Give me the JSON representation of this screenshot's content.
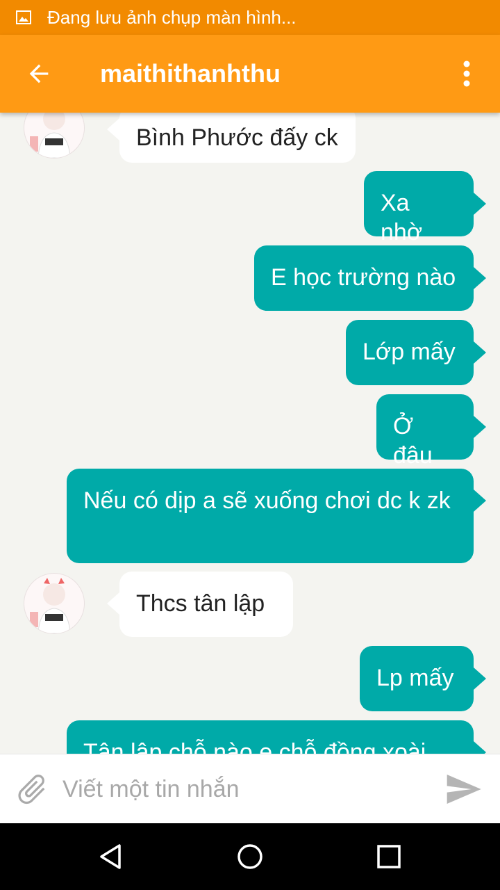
{
  "status_bar": {
    "icon": "image-icon",
    "text": "Đang lưu ảnh chụp màn hình..."
  },
  "app_bar": {
    "back_icon": "arrow-left-icon",
    "title": "maithithanhthu",
    "menu_icon": "more-vert-icon"
  },
  "colors": {
    "status_bar": "#f28a00",
    "app_bar": "#ff9a14",
    "outgoing_bubble": "#00aaa8",
    "incoming_bubble": "#ffffff",
    "background": "#f4f4f0"
  },
  "messages": [
    {
      "direction": "incoming",
      "text": "Bình Phước đấy ck"
    },
    {
      "direction": "outgoing",
      "text": "Xa nhờ"
    },
    {
      "direction": "outgoing",
      "text": "E học trường nào"
    },
    {
      "direction": "outgoing",
      "text": "Lớp mấy"
    },
    {
      "direction": "outgoing",
      "text": "Ở đâu"
    },
    {
      "direction": "outgoing",
      "text": "Nếu có dịp a sẽ xuống chơi dc k zk"
    },
    {
      "direction": "incoming",
      "text": "Thcs tân lập"
    },
    {
      "direction": "outgoing",
      "text": "Lp mấy"
    },
    {
      "direction": "outgoing",
      "text": "Tân lập chỗ nào e chỗ đồng xoài"
    }
  ],
  "composer": {
    "attach_icon": "paperclip-icon",
    "placeholder": "Viết một tin nhắn",
    "send_icon": "send-icon"
  },
  "nav_bar": {
    "back_icon": "triangle-back-icon",
    "home_icon": "circle-home-icon",
    "recents_icon": "square-recents-icon"
  }
}
